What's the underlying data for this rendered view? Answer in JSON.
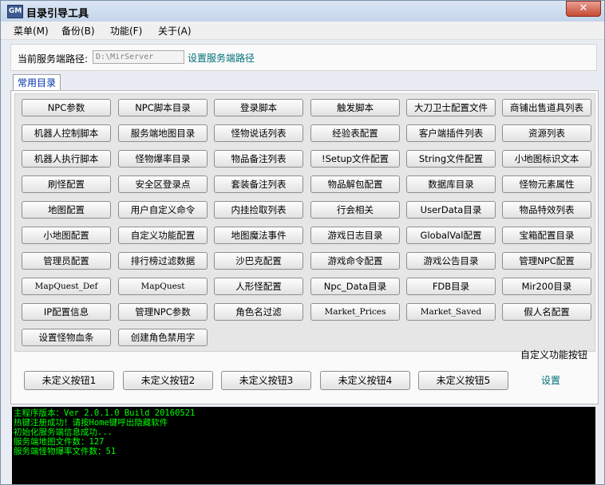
{
  "window": {
    "title": "目录引导工具",
    "icon_text": "GM",
    "close_symbol": "✕"
  },
  "menu": [
    {
      "label": "菜单(M)"
    },
    {
      "label": "备份(B)"
    },
    {
      "label": "功能(F)"
    },
    {
      "label": "关于(A)"
    }
  ],
  "path": {
    "label": "当前服务端路径:",
    "value": "D:\\MirServer",
    "set_link": "设置服务端路径"
  },
  "tab": {
    "label": "常用目录"
  },
  "buttons": [
    [
      "NPC参数",
      "NPC脚本目录",
      "登录脚本",
      "触发脚本",
      "大刀卫士配置文件",
      "商铺出售道具列表"
    ],
    [
      "机器人控制脚本",
      "服务端地图目录",
      "怪物说话列表",
      "经验表配置",
      "客户端插件列表",
      "资源列表"
    ],
    [
      "机器人执行脚本",
      "怪物爆率目录",
      "物品备注列表",
      "!Setup文件配置",
      "String文件配置",
      "小地图标识文本"
    ],
    [
      "刷怪配置",
      "安全区登录点",
      "套装备注列表",
      "物品解包配置",
      "数据库目录",
      "怪物元素属性"
    ],
    [
      "地图配置",
      "用户自定义命令",
      "内挂捡取列表",
      "行会相关",
      "UserData目录",
      "物品特效列表"
    ],
    [
      "小地图配置",
      "自定义功能配置",
      "地图魔法事件",
      "游戏日志目录",
      "GlobalVal配置",
      "宝箱配置目录"
    ],
    [
      "管理员配置",
      "排行榜过滤数据",
      "沙巴克配置",
      "游戏命令配置",
      "游戏公告目录",
      "管理NPC配置"
    ],
    [
      "MapQuest_Def",
      "MapQuest",
      "人形怪配置",
      "Npc_Data目录",
      "FDB目录",
      "Mir200目录"
    ],
    [
      "IP配置信息",
      "管理NPC参数",
      "角色名过滤",
      "Market_Prices",
      "Market_Saved",
      "假人名配置"
    ],
    [
      "设置怪物血条",
      "创建角色禁用字"
    ]
  ],
  "custom": {
    "title": "自定义功能按钮",
    "buttons": [
      "未定义按钮1",
      "未定义按钮2",
      "未定义按钮3",
      "未定义按钮4",
      "未定义按钮5"
    ],
    "setting_link": "设置"
  },
  "console": {
    "lines": [
      "主程序版本：Ver 2.0.1.0 Build 20160521",
      "热键注册成功！请按Home键呼出隐藏软件",
      "初始化服务端信息成功...",
      "服务端地图文件数：127",
      "服务端怪物爆率文件数：51"
    ]
  },
  "colors": {
    "link": "#006f78",
    "console_bg": "#000000",
    "console_text": "#00ff00",
    "tab_text": "#0033aa"
  }
}
